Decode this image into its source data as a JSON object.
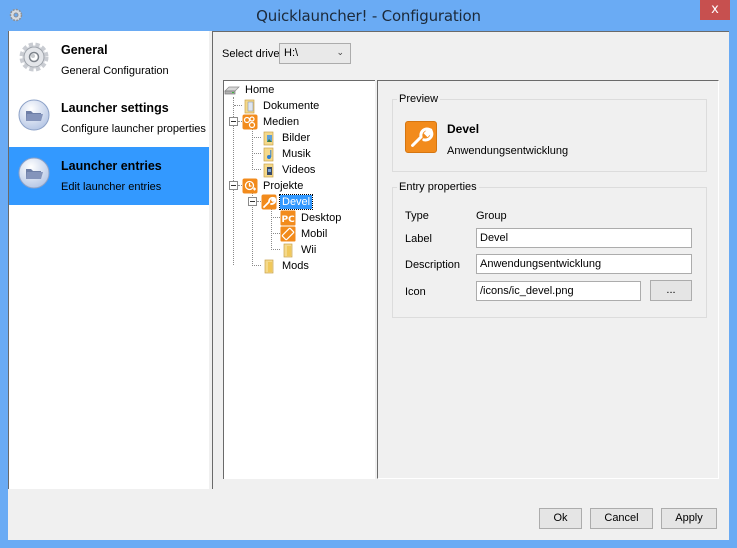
{
  "window": {
    "title": "Quicklauncher! - Configuration",
    "close_label": "x"
  },
  "sidebar": {
    "items": [
      {
        "title": "General",
        "subtitle": "General Configuration",
        "icon": "gear-icon",
        "active": false
      },
      {
        "title": "Launcher settings",
        "subtitle": "Configure launcher properties",
        "icon": "folder-orb-icon",
        "active": false
      },
      {
        "title": "Launcher entries",
        "subtitle": "Edit launcher entries",
        "icon": "folder-orb-icon",
        "active": true
      }
    ]
  },
  "drive": {
    "label": "Select drive",
    "value": "H:\\"
  },
  "tree": {
    "items": [
      {
        "label": "Home",
        "icon": "drive-icon",
        "level": 0
      },
      {
        "label": "Dokumente",
        "icon": "folder-documents-icon",
        "level": 1
      },
      {
        "label": "Medien",
        "icon": "media-group-icon",
        "level": 1,
        "expanded": true
      },
      {
        "label": "Bilder",
        "icon": "folder-pictures-icon",
        "level": 2
      },
      {
        "label": "Musik",
        "icon": "folder-music-icon",
        "level": 2
      },
      {
        "label": "Videos",
        "icon": "folder-videos-icon",
        "level": 2
      },
      {
        "label": "Projekte",
        "icon": "projects-group-icon",
        "level": 1,
        "expanded": true
      },
      {
        "label": "Devel",
        "icon": "wrench-icon",
        "level": 2,
        "expanded": true,
        "selected": true
      },
      {
        "label": "Desktop",
        "icon": "pc-icon",
        "level": 3
      },
      {
        "label": "Mobil",
        "icon": "mobile-icon",
        "level": 3
      },
      {
        "label": "Wii",
        "icon": "folder-icon",
        "level": 3
      },
      {
        "label": "Mods",
        "icon": "folder-icon",
        "level": 2
      }
    ]
  },
  "preview": {
    "legend": "Preview",
    "title": "Devel",
    "description": "Anwendungsentwicklung"
  },
  "properties": {
    "legend": "Entry properties",
    "type_label": "Type",
    "type_value": "Group",
    "label_label": "Label",
    "label_value": "Devel",
    "description_label": "Description",
    "description_value": "Anwendungsentwicklung",
    "icon_label": "Icon",
    "icon_value": "/icons/ic_devel.png",
    "browse_label": "..."
  },
  "buttons": {
    "ok": "Ok",
    "cancel": "Cancel",
    "apply": "Apply"
  },
  "colors": {
    "frame": "#6aabf4",
    "selection": "#3399ff",
    "accent_orange": "#f28b1c",
    "close": "#c7504f"
  }
}
